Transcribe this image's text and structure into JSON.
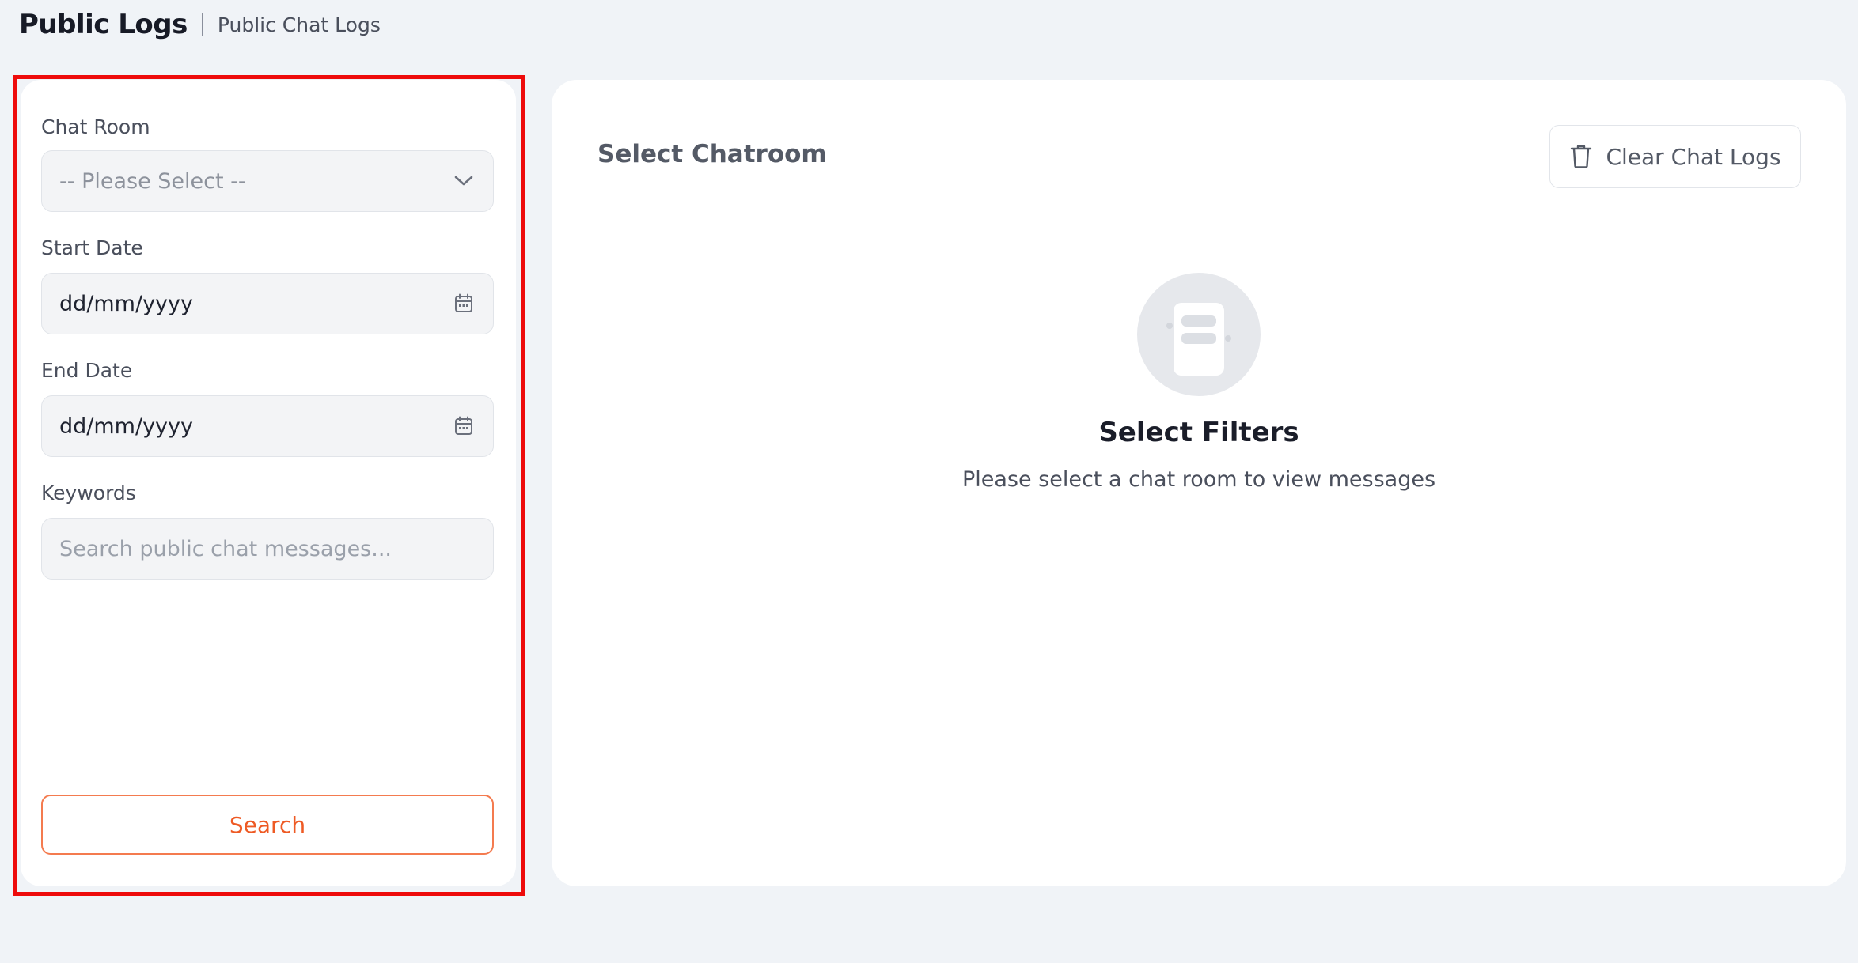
{
  "header": {
    "title": "Public Logs",
    "subtitle": "Public Chat Logs"
  },
  "filters": {
    "chat_room": {
      "label": "Chat Room",
      "value": "-- Please Select --",
      "icon": "chevron-down-icon"
    },
    "start_date": {
      "label": "Start Date",
      "value": "dd/mm/yyyy",
      "icon": "calendar-icon"
    },
    "end_date": {
      "label": "End Date",
      "value": "dd/mm/yyyy",
      "icon": "calendar-icon"
    },
    "keywords": {
      "label": "Keywords",
      "placeholder": "Search public chat messages..."
    },
    "search_label": "Search"
  },
  "main": {
    "title": "Select Chatroom",
    "clear_label": "Clear Chat Logs",
    "clear_icon": "trash-icon",
    "empty": {
      "icon": "chat-messages-icon",
      "title": "Select Filters",
      "description": "Please select a chat room to view messages"
    }
  },
  "colors": {
    "accent": "#ee5a24",
    "highlight": "#ee0b0b",
    "background": "#f0f3f7"
  }
}
